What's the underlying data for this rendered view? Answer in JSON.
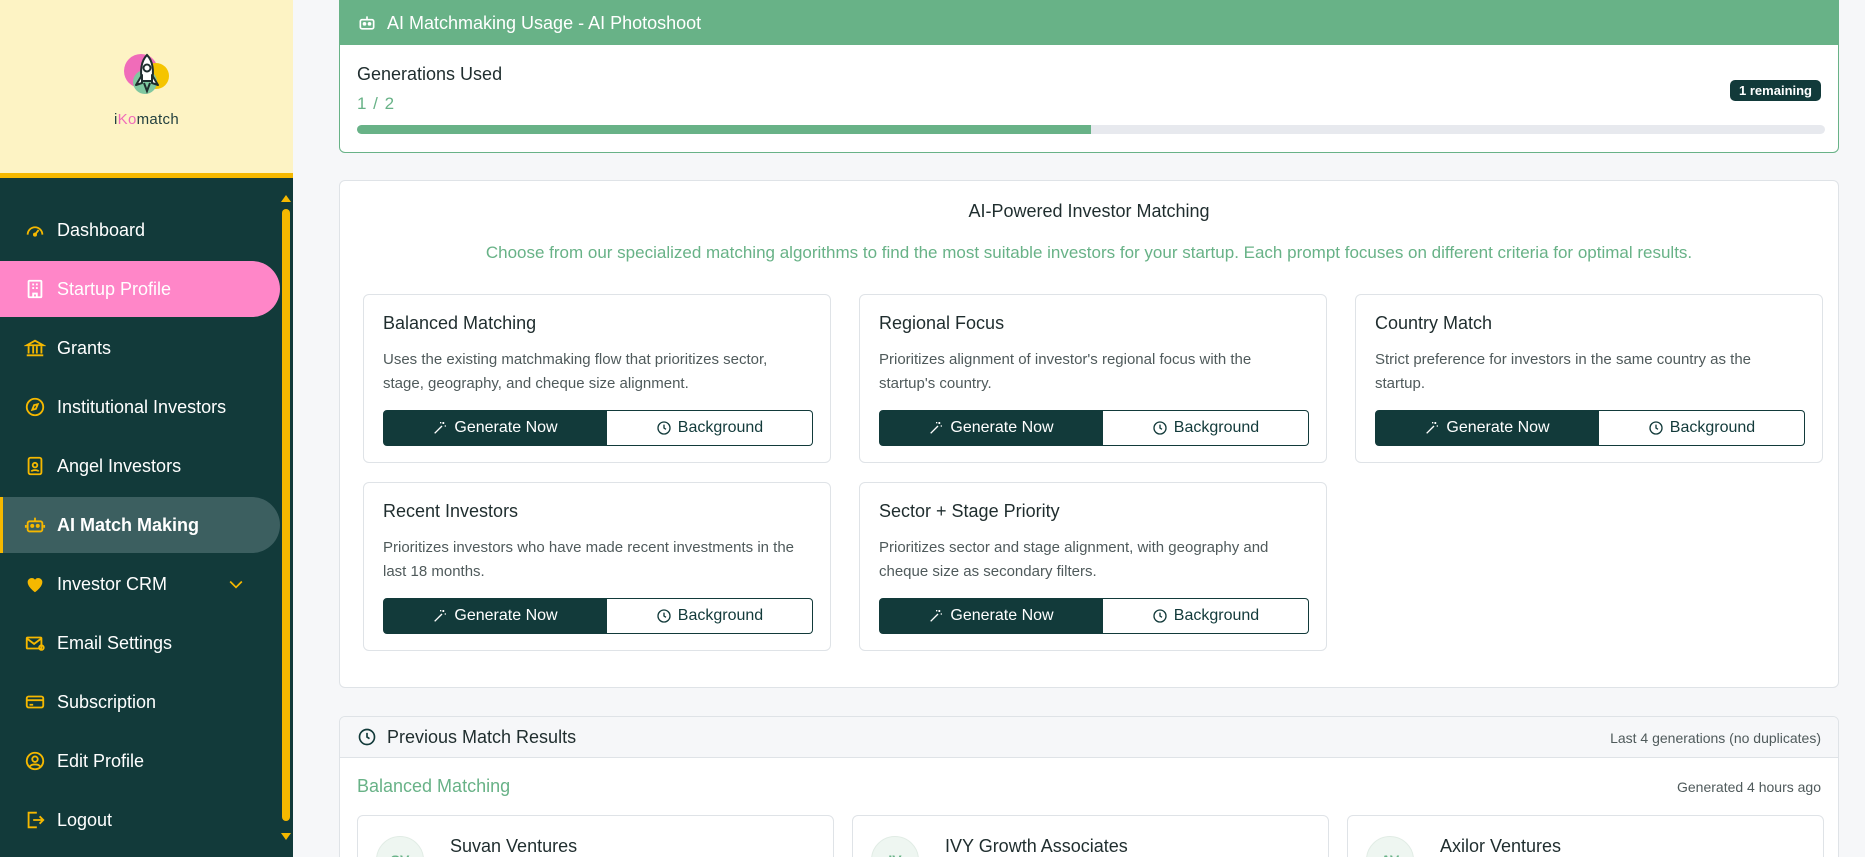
{
  "brand": {
    "name_prefix": "i",
    "name_accent": "Ko",
    "name_suffix": "match"
  },
  "sidebar": {
    "items": [
      {
        "label": "Dashboard",
        "icon": "gauge-icon"
      },
      {
        "label": "Startup Profile",
        "icon": "building-icon"
      },
      {
        "label": "Grants",
        "icon": "bank-icon"
      },
      {
        "label": "Institutional Investors",
        "icon": "compass-icon"
      },
      {
        "label": "Angel Investors",
        "icon": "id-badge-icon"
      },
      {
        "label": "AI Match Making",
        "icon": "robot-icon"
      },
      {
        "label": "Investor CRM",
        "icon": "heart-icon"
      },
      {
        "label": "Email Settings",
        "icon": "envelope-gear-icon"
      },
      {
        "label": "Subscription",
        "icon": "credit-card-icon"
      },
      {
        "label": "Edit Profile",
        "icon": "user-circle-icon"
      },
      {
        "label": "Logout",
        "icon": "logout-icon"
      }
    ]
  },
  "usage": {
    "title": "AI Matchmaking Usage - AI Photoshoot",
    "label": "Generations Used",
    "value": "1 / 2",
    "remaining": "1 remaining",
    "progress_fraction": 0.5
  },
  "matching": {
    "title": "AI-Powered Investor Matching",
    "subtitle": "Choose from our specialized matching algorithms to find the most suitable investors for your startup. Each prompt focuses on different criteria for optimal results.",
    "generate_label": "Generate Now",
    "background_label": "Background",
    "algorithms": [
      {
        "title": "Balanced Matching",
        "desc": "Uses the existing matchmaking flow that prioritizes sector, stage, geography, and cheque size alignment."
      },
      {
        "title": "Regional Focus",
        "desc": "Prioritizes alignment of investor's regional focus with the startup's country."
      },
      {
        "title": "Country Match",
        "desc": "Strict preference for investors in the same country as the startup."
      },
      {
        "title": "Recent Investors",
        "desc": "Prioritizes investors who have made recent investments in the last 18 months."
      },
      {
        "title": "Sector + Stage Priority",
        "desc": "Prioritizes sector and stage alignment, with geography and cheque size as secondary filters."
      }
    ]
  },
  "previous": {
    "title": "Previous Match Results",
    "meta": "Last 4 generations (no duplicates)",
    "group_title": "Balanced Matching",
    "generated": "Generated 4 hours ago",
    "investors": [
      {
        "initials": "SV",
        "name": "Suvan Ventures"
      },
      {
        "initials": "IV",
        "name": "IVY Growth Associates"
      },
      {
        "initials": "AV",
        "name": "Axilor Ventures"
      }
    ]
  },
  "colors": {
    "sidebar_bg": "#123a3a",
    "accent_green": "#68b287",
    "accent_yellow": "#f5b800",
    "active_pink": "#ff86c8"
  }
}
